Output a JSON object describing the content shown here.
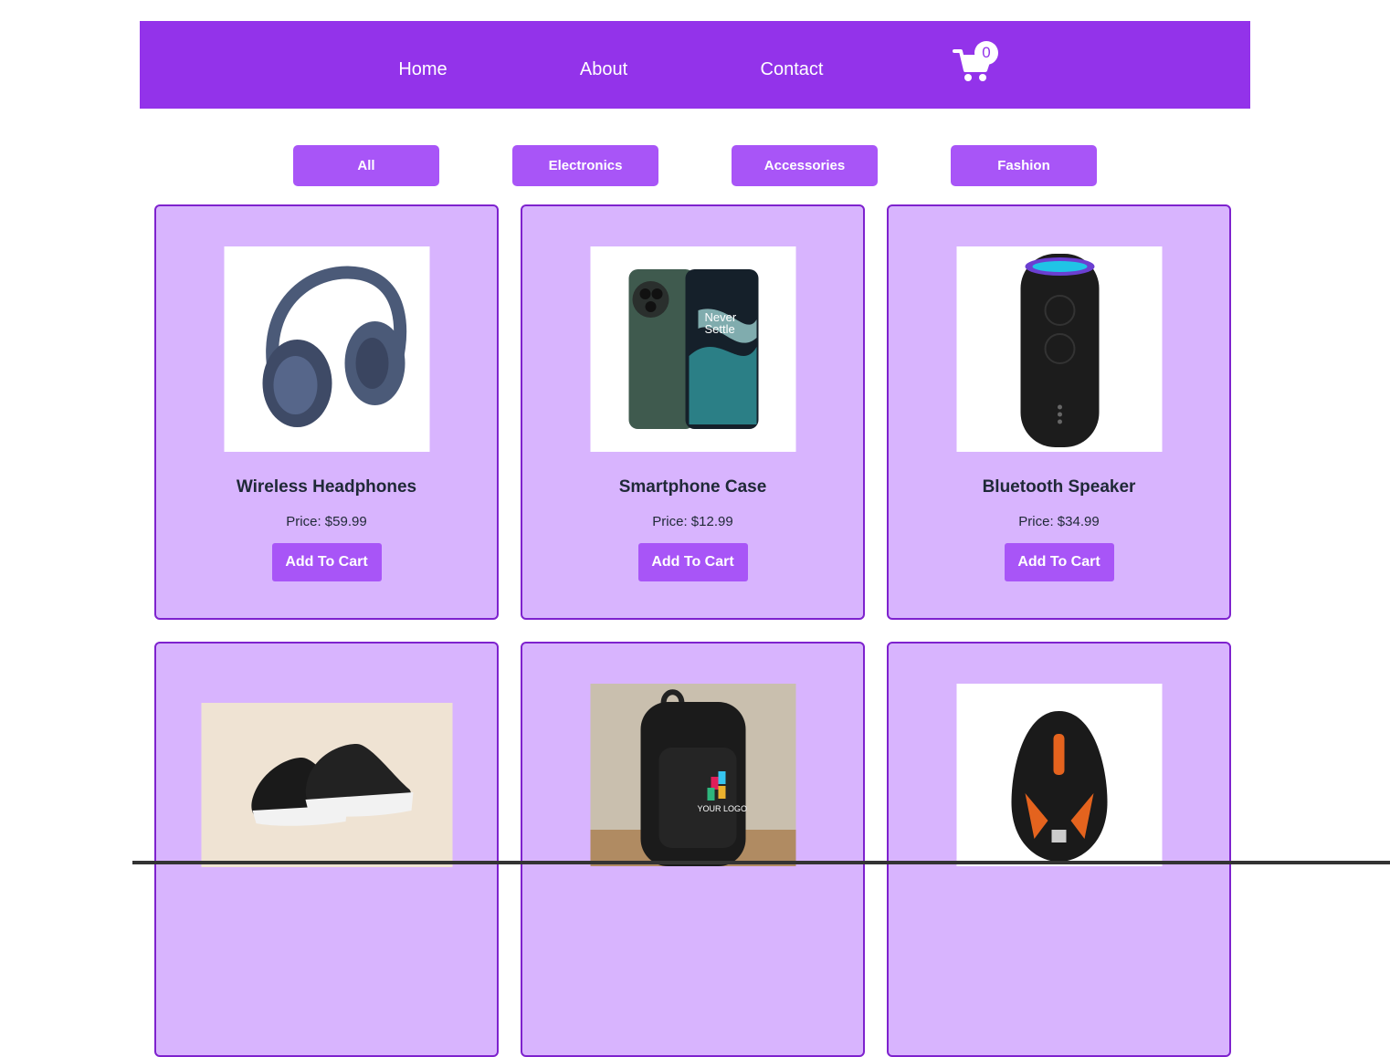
{
  "nav": {
    "links": [
      "Home",
      "About",
      "Contact"
    ],
    "cart_count": "0",
    "cart_icon": "shopping-cart-icon"
  },
  "filters": [
    "All",
    "Electronics",
    "Accessories",
    "Fashion"
  ],
  "products": [
    {
      "name": "Wireless Headphones",
      "price": "Price: $59.99",
      "button": "Add To Cart",
      "image": "headphones-image"
    },
    {
      "name": "Smartphone Case",
      "price": "Price: $12.99",
      "button": "Add To Cart",
      "image": "smartphone-image",
      "image_text": [
        "Never",
        "Settle"
      ]
    },
    {
      "name": "Bluetooth Speaker",
      "price": "Price: $34.99",
      "button": "Add To Cart",
      "image": "speaker-image"
    },
    {
      "name": "",
      "price": "",
      "button": "",
      "image": "sneakers-image"
    },
    {
      "name": "",
      "price": "",
      "button": "",
      "image": "backpack-image",
      "image_text": [
        "YOUR LOGO"
      ]
    },
    {
      "name": "",
      "price": "",
      "button": "",
      "image": "gaming-mouse-image"
    }
  ],
  "colors": {
    "navbar": "#9333ea",
    "button": "#a855f7",
    "card_bg": "#d8b4fe",
    "card_border": "#7e22ce"
  }
}
